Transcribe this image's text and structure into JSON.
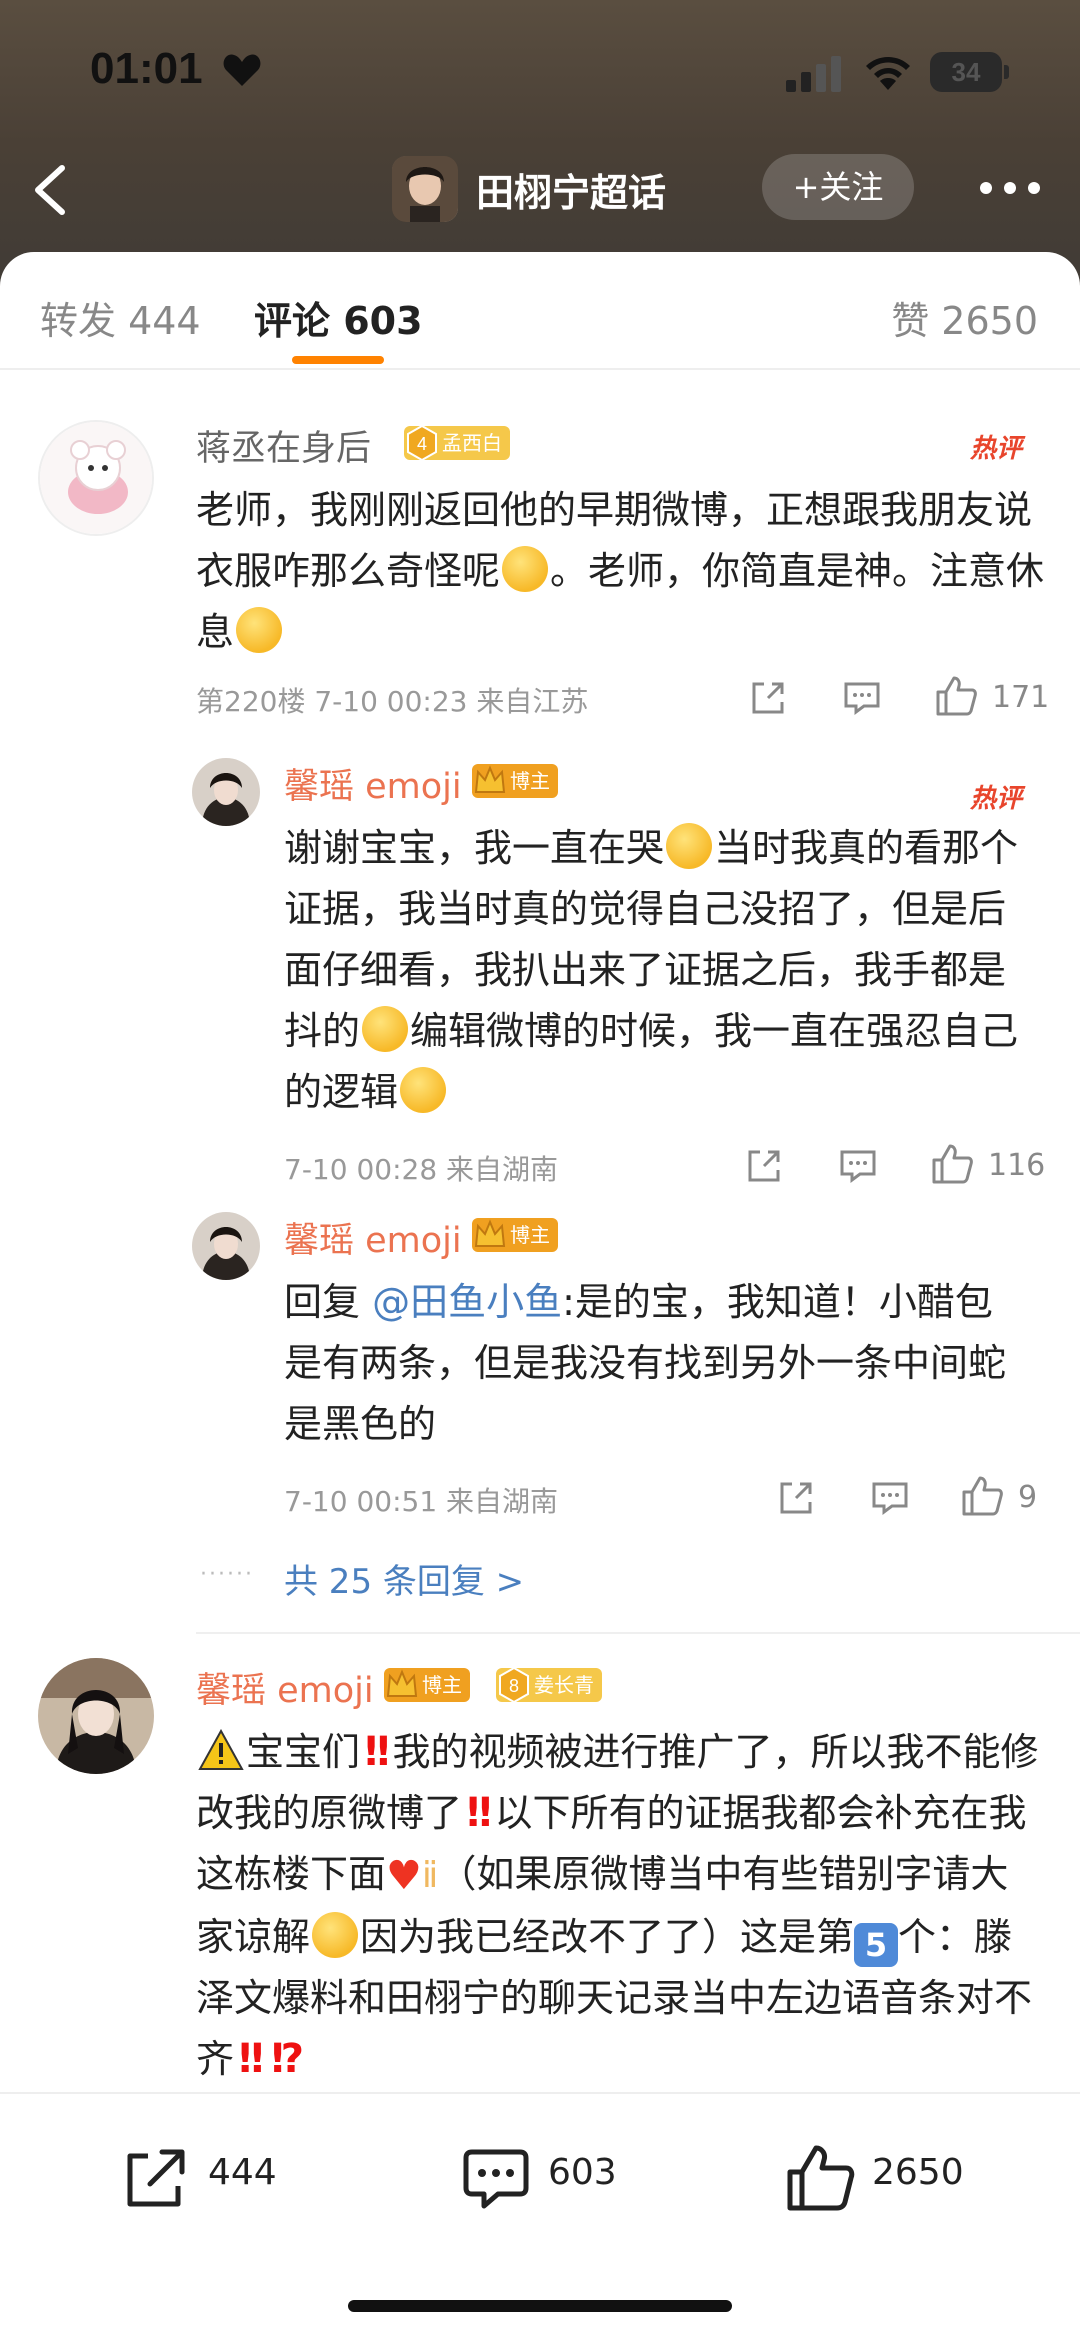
{
  "status_bar": {
    "time": "01:01",
    "battery": "34"
  },
  "nav": {
    "title": "田栩宁超话",
    "follow_label": "+关注"
  },
  "tabs": {
    "repost": "转发 444",
    "comment": "评论 603",
    "like": "赞 2650"
  },
  "hot_label": "热评",
  "comments": [
    {
      "username": "蒋丞在身后",
      "badge_level": "4",
      "badge_text": "孟西白",
      "text_parts": [
        "老师，我刚刚返回他的早期微博，正想跟我朋友说衣服咋那么奇怪呢",
        "。老师，你简直是神。注意休息"
      ],
      "meta": "第220楼 7-10 00:23 来自江苏",
      "likes": "171",
      "replies": [
        {
          "username": "馨瑶 emoji",
          "badge_text": "博主",
          "text_parts": [
            "谢谢宝宝，我一直在哭",
            "当时我真的看那个证据，我当时真的觉得自己没招了，但是后面仔细看，我扒出来了证据之后，我手都是抖的",
            "编辑微博的时候，我一直在强忍自己的逻辑"
          ],
          "meta": "7-10 00:28 来自湖南",
          "likes": "116"
        },
        {
          "username": "馨瑶 emoji",
          "badge_text": "博主",
          "reply_prefix": "回复",
          "mention": "@田鱼小鱼",
          "text": ":是的宝，我知道！小醋包是有两条，但是我没有找到另外一条中间蛇是黑色的",
          "meta": "7-10 00:51 来自湖南",
          "likes": "9"
        }
      ],
      "more_replies": "共 25 条回复 >"
    },
    {
      "username": "馨瑶 emoji",
      "badge_text": "博主",
      "badge_level": "8",
      "badge_text_2": "姜长青",
      "text_parts": [
        "宝宝们",
        "我的视频被进行推广了，所以我不能修改我的原微博了",
        "以下所有的证据我都会补充在我这栋楼下面",
        "（如果原微博当中有些错别字请大家谅解",
        "因为我已经改不了了）这是第",
        "个：滕泽文爆料和田栩宁的聊天记录当中左边语音条对不齐"
      ],
      "five": "5"
    }
  ],
  "bottom_bar": {
    "repost": "444",
    "comment": "603",
    "like": "2650"
  },
  "colors": {
    "accent": "#ff8200",
    "username_orange": "#eb7350",
    "link_blue": "#4a7fbf",
    "hot_red": "#e8452c"
  }
}
